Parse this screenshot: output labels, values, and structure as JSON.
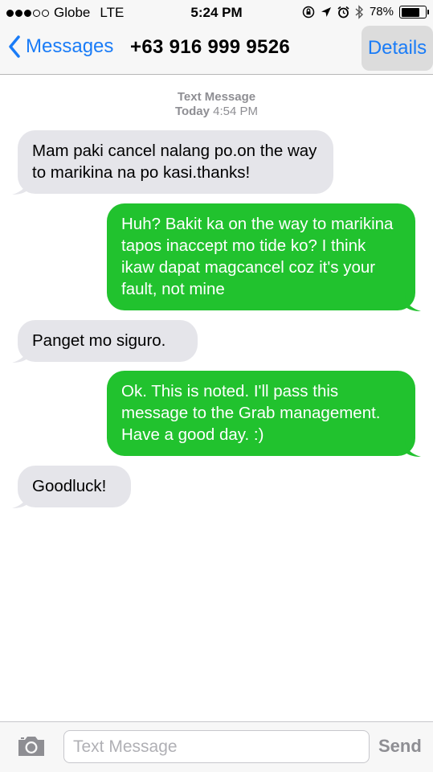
{
  "status_bar": {
    "carrier": "Globe",
    "network": "LTE",
    "time": "5:24 PM",
    "battery_percent": "78%",
    "battery_level": 0.78,
    "signal_bars_filled": 3,
    "signal_bars_total": 5,
    "icons": [
      "orientation-lock-icon",
      "location-icon",
      "alarm-icon",
      "bluetooth-icon",
      "battery-icon"
    ]
  },
  "nav": {
    "back_label": "Messages",
    "title": "+63 916 999 9526",
    "details_label": "Details",
    "accent_color": "#1a7cf7"
  },
  "thread": {
    "meta_type": "Text Message",
    "meta_day": "Today",
    "meta_time": "4:54 PM",
    "messages": [
      {
        "direction": "incoming",
        "text": "Mam paki cancel nalang po.on the way to marikina na po kasi.thanks!"
      },
      {
        "direction": "outgoing",
        "text": "Huh? Bakit ka on the way to marikina tapos inaccept mo tide ko? I think ikaw dapat magcancel coz it's your fault, not mine"
      },
      {
        "direction": "incoming",
        "text": "Panget mo siguro."
      },
      {
        "direction": "outgoing",
        "text": "Ok. This is noted. I'll pass this message to the Grab management. Have a good day. :)"
      },
      {
        "direction": "incoming",
        "text": "Goodluck!"
      }
    ],
    "incoming_color": "#e5e5ea",
    "outgoing_color": "#21c22e"
  },
  "composer": {
    "placeholder": "Text Message",
    "send_label": "Send",
    "camera_icon": "camera-icon"
  }
}
